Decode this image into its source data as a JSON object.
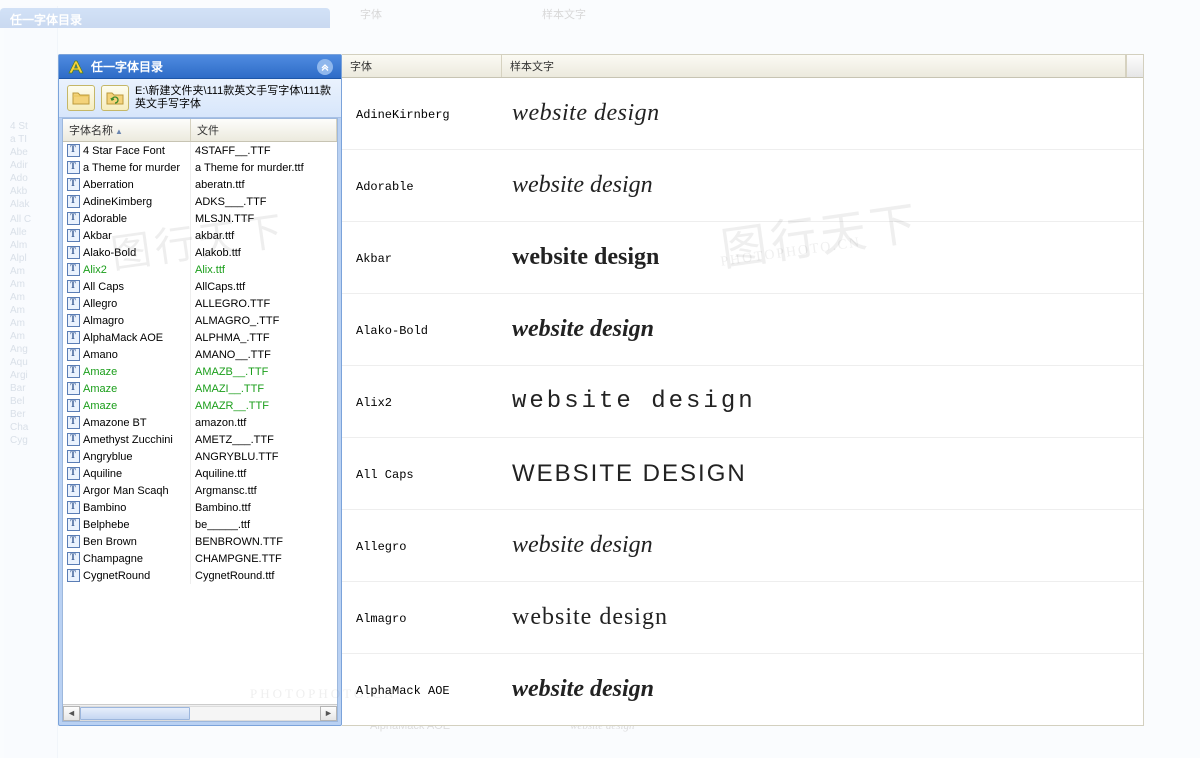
{
  "panel": {
    "title": "任一字体目录",
    "path": "E:\\新建文件夹\\111款英文手写字体\\111款英文手写字体"
  },
  "columns": {
    "name": "字体名称",
    "file": "文件"
  },
  "preview_columns": {
    "font": "字体",
    "sample": "样本文字"
  },
  "ghost": {
    "title": "任一字体目录",
    "head_font": "字体",
    "head_sample": "样本文字",
    "bottom_name": "AlphaMack AOE",
    "bottom_sample": "website design"
  },
  "fonts": [
    {
      "name": "4 Star Face Font",
      "file": "4STAFF__.TTF"
    },
    {
      "name": "a Theme for murder",
      "file": "a Theme for murder.ttf"
    },
    {
      "name": "Aberration",
      "file": "aberatn.ttf"
    },
    {
      "name": "AdineKimberg",
      "file": "ADKS___.TTF"
    },
    {
      "name": "Adorable",
      "file": "MLSJN.TTF"
    },
    {
      "name": "Akbar",
      "file": "akbar.ttf"
    },
    {
      "name": "Alako-Bold",
      "file": "Alakob.ttf"
    },
    {
      "name": "Alix2",
      "file": "Alix.ttf",
      "hl": true
    },
    {
      "name": "All Caps",
      "file": "AllCaps.ttf"
    },
    {
      "name": "Allegro",
      "file": "ALLEGRO.TTF"
    },
    {
      "name": "Almagro",
      "file": "ALMAGRO_.TTF"
    },
    {
      "name": "AlphaMack AOE",
      "file": "ALPHMA_.TTF"
    },
    {
      "name": "Amano",
      "file": "AMANO__.TTF"
    },
    {
      "name": "Amaze",
      "file": "AMAZB__.TTF",
      "hl": true
    },
    {
      "name": "Amaze",
      "file": "AMAZI__.TTF",
      "hl": true
    },
    {
      "name": "Amaze",
      "file": "AMAZR__.TTF",
      "hl": true
    },
    {
      "name": "Amazone BT",
      "file": "amazon.ttf"
    },
    {
      "name": "Amethyst Zucchini",
      "file": "AMETZ___.TTF"
    },
    {
      "name": "Angryblue",
      "file": "ANGRYBLU.TTF"
    },
    {
      "name": "Aquiline",
      "file": "Aquiline.ttf"
    },
    {
      "name": "Argor Man Scaqh",
      "file": "Argmansc.ttf"
    },
    {
      "name": "Bambino",
      "file": "Bambino.ttf"
    },
    {
      "name": "Belphebe",
      "file": "be_____.ttf"
    },
    {
      "name": "Ben Brown",
      "file": "BENBROWN.TTF"
    },
    {
      "name": "Champagne",
      "file": "CHAMPGNE.TTF"
    },
    {
      "name": "CygnetRound",
      "file": "CygnetRound.ttf"
    }
  ],
  "preview": [
    {
      "name": "AdineKirnberg",
      "sample": "website design",
      "cls": "s-kirnberg"
    },
    {
      "name": "Adorable",
      "sample": "website design",
      "cls": "s-adorable"
    },
    {
      "name": "Akbar",
      "sample": "website design",
      "cls": "s-akbar"
    },
    {
      "name": "Alako-Bold",
      "sample": "website design",
      "cls": "s-alako"
    },
    {
      "name": "Alix2",
      "sample": "website design",
      "cls": "s-alix"
    },
    {
      "name": "All Caps",
      "sample": "WEBSITE DESIGN",
      "cls": "s-allcaps"
    },
    {
      "name": "Allegro",
      "sample": "website design",
      "cls": "s-allegro"
    },
    {
      "name": "Almagro",
      "sample": "website design",
      "cls": "s-almagro"
    },
    {
      "name": "AlphaMack AOE",
      "sample": "website design",
      "cls": "s-alpha"
    }
  ],
  "watermark": {
    "text": "图行天下",
    "url": "PHOTOPHOTO.CN"
  }
}
